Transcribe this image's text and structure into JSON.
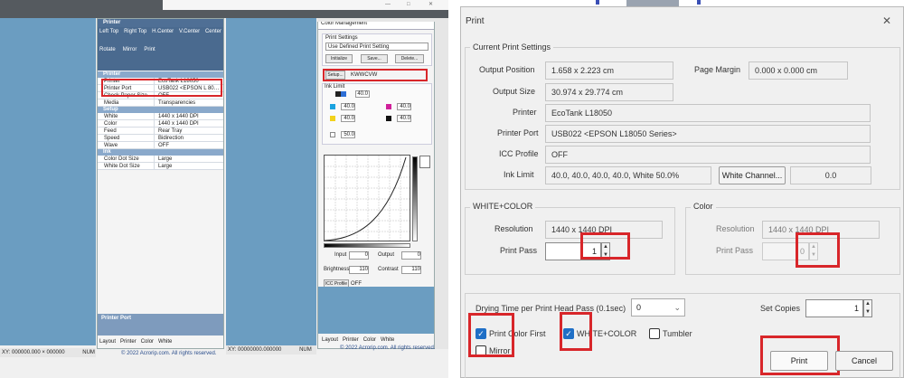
{
  "left_app": {
    "print_panel": {
      "title": "Printer",
      "tools": [
        "Left Top",
        "Right Top",
        "H.Center",
        "V.Center",
        "Center"
      ],
      "tools2": [
        "Rotate",
        "Mirror",
        "Print"
      ],
      "rows": [
        {
          "k": "Printer",
          "v": "EcoTank L18050"
        },
        {
          "k": "Printer Port",
          "v": "USB022 <EPSON L 80…"
        },
        {
          "k": "Check Paper Size",
          "v": "OFF"
        },
        {
          "k": "Media",
          "v": "Transparencies"
        }
      ],
      "setup_header": "Setup",
      "setup_rows": [
        {
          "k": "White",
          "v": "1440 x 1440 DPI"
        },
        {
          "k": "Color",
          "v": "1440 x 1440 DPI"
        },
        {
          "k": "Feed",
          "v": "Rear Tray"
        },
        {
          "k": "Speed",
          "v": "Bidirection"
        },
        {
          "k": "Wave",
          "v": "OFF"
        }
      ],
      "ink_header": "Ink",
      "ink_rows": [
        {
          "k": "Color Dot Size",
          "v": "Large"
        },
        {
          "k": "White Dot Size",
          "v": "Large"
        }
      ],
      "printer_port_label": "Printer Port",
      "bottom_tabs": [
        "Layout",
        "Printer",
        "Color",
        "White"
      ]
    },
    "status_left": [
      "XY: 000000.000 × 000000",
      "NUM"
    ],
    "copyright_left": "© 2022 Acrorip.com. All rights reserved.",
    "color_panel": {
      "title": "Color Management",
      "print_settings_label": "Print Settings",
      "print_settings_value": "Use Defined Print Setting",
      "buttons": [
        "Initialize",
        "Save...",
        "Delete..."
      ],
      "setup_button": "Setup...",
      "setup_value": "KWWCVW",
      "ink_limit_label": "Ink Limit",
      "values": [
        "40.0",
        "40.0",
        "40.0",
        "40.0",
        "40.0",
        "50.0"
      ],
      "input_label": "Input",
      "input_value": "0",
      "output_label": "Output",
      "output_value": "0",
      "brightness_label": "Brightness",
      "brightness_value": "110",
      "contrast_label": "Contrast",
      "contrast_value": "110",
      "icc_profile_label": "ICC Profile",
      "icc_value": "OFF",
      "bottom_tabs": [
        "Layout",
        "Printer",
        "Color",
        "White"
      ]
    },
    "status_right": [
      "XY: 00000000.000000",
      "NUM"
    ],
    "copyright_right": "© 2022 Acrorip.com. All rights reserved."
  },
  "dialog": {
    "title": "Print",
    "current_settings_label": "Current Print Settings",
    "output_position_label": "Output Position",
    "output_position_value": "1.658 x 2.223 cm",
    "page_margin_label": "Page Margin",
    "page_margin_value": "0.000 x 0.000 cm",
    "output_size_label": "Output Size",
    "output_size_value": "30.974 x 29.774 cm",
    "printer_label": "Printer",
    "printer_value": "EcoTank L18050",
    "printer_port_label": "Printer Port",
    "printer_port_value": "USB022 <EPSON L18050 Series>",
    "icc_profile_label": "ICC Profile",
    "icc_profile_value": "OFF",
    "ink_limit_label": "Ink Limit",
    "ink_limit_value": "40.0, 40.0, 40.0, 40.0, White 50.0%",
    "white_channel_button": "White Channel...",
    "white_channel_value": "0.0",
    "white_color_group": "WHITE+COLOR",
    "wc_resolution_label": "Resolution",
    "wc_resolution_value": "1440 x 1440 DPI",
    "wc_pass_label": "Print Pass",
    "wc_pass_value": "1",
    "color_group": "Color",
    "c_resolution_label": "Resolution",
    "c_resolution_value": "1440 x 1440 DPI",
    "c_pass_label": "Print Pass",
    "c_pass_value": "0",
    "drying_label": "Drying Time per Print Head Pass (0.1sec)",
    "drying_value": "0",
    "set_copies_label": "Set Copies",
    "set_copies_value": "1",
    "print_color_first_label": "Print Color First",
    "print_color_first_checked": true,
    "white_color_cb_label": "WHITE+COLOR",
    "white_color_checked": true,
    "tumbler_label": "Tumbler",
    "tumbler_checked": false,
    "mirror_label": "Mirror",
    "mirror_checked": false,
    "print_button": "Print",
    "cancel_button": "Cancel"
  },
  "colors": {
    "canvas_blue": "#6b9dc1",
    "highlight_red": "#d8262a",
    "checkbox_blue": "#1f6fc6"
  }
}
